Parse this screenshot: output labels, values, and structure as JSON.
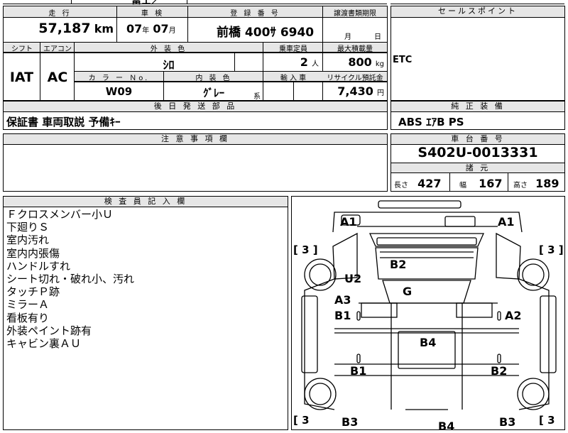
{
  "top_partial": {
    "text": "富士／"
  },
  "mileage": {
    "header": "走 行",
    "value": "57,187",
    "unit": "km"
  },
  "inspection": {
    "header": "車 検",
    "year": "07",
    "year_unit": "年",
    "month": "07",
    "month_unit": "月"
  },
  "registration": {
    "header": "登 録 番 号",
    "value": "前橋 400ｻ 6940"
  },
  "transfer": {
    "header": "譲渡書類期限",
    "month_unit": "月",
    "day_unit": "日"
  },
  "selling_points": {
    "header": "セールスポイント",
    "text": "ETC"
  },
  "shift": {
    "header": "シフト",
    "value": "IAT"
  },
  "aircon": {
    "header": "エアコン",
    "value": "AC"
  },
  "exterior_color": {
    "header": "外 装 色",
    "value": "ｼﾛ"
  },
  "capacity": {
    "header": "乗車定員",
    "value": "2",
    "unit": "人"
  },
  "max_load": {
    "header": "最大積載量",
    "value": "800",
    "unit": "kg"
  },
  "color_no": {
    "header": "カ ラ ー Ｎo.",
    "value": "W09"
  },
  "interior_color": {
    "header": "内 装 色",
    "value": "ｸﾞﾚｰ",
    "suffix": "系"
  },
  "import": {
    "header": "輸 入 車"
  },
  "recycle": {
    "header": "リサイクル預託金",
    "value": "7,430",
    "unit": "円"
  },
  "delivery": {
    "header": "後 日 発 送 部 品",
    "value": "保証書 車両取説 予備ｷｰ"
  },
  "equipment": {
    "header": "純 正 装 備",
    "value": "ABS ｴｱB PS"
  },
  "notes": {
    "header": "注 意 事 項 欄"
  },
  "chassis": {
    "header": "車 台 番 号",
    "value": "S402U-0013331"
  },
  "specs": {
    "header": "諸 元",
    "length_label": "長さ",
    "length": "427",
    "width_label": "幅",
    "width": "167",
    "height_label": "高さ",
    "height": "189"
  },
  "inspector": {
    "header": "検 査 員 記 入 欄",
    "remarks": [
      "Ｆクロスメンバー小Ｕ",
      "下廻りＳ",
      "室内汚れ",
      "室内内張傷",
      "ハンドルすれ",
      "シート切れ・破れ小、汚れ",
      "タッチＰ跡",
      "ミラーＡ",
      "看板有り",
      "外装ペイント跡有",
      "キャビン裏ＡＵ"
    ]
  },
  "diagram": {
    "brackets": [
      "[ 3 ]",
      "[ 3 ]",
      "[ 3",
      "[ 3"
    ],
    "labels": [
      "A1",
      "A1",
      "B2",
      "U2",
      "G",
      "A3",
      "B1",
      "A2",
      "B4",
      "B1",
      "B2",
      "B3",
      "B4",
      "B3"
    ]
  }
}
